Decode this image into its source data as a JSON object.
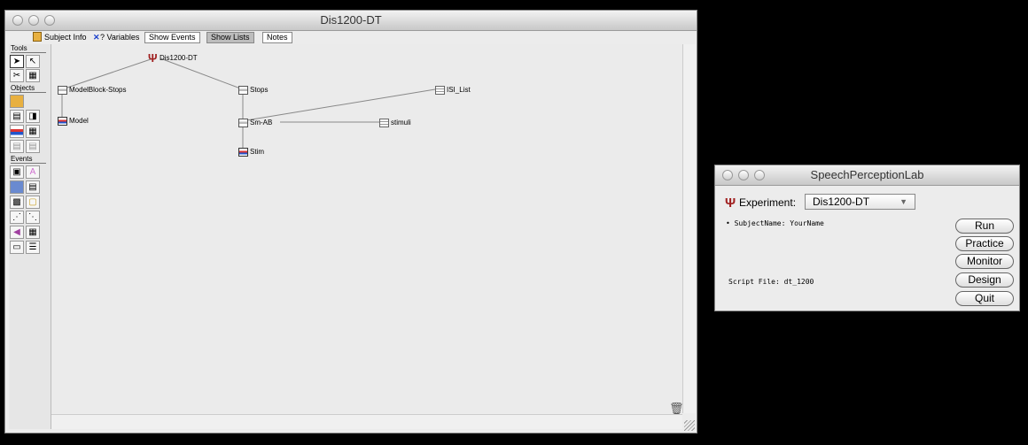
{
  "main_window": {
    "title": "Dis1200-DT",
    "toolbar": {
      "subject_info": "Subject Info",
      "variables": "? Variables",
      "show_events": "Show Events",
      "show_lists": "Show Lists",
      "notes": "Notes"
    },
    "palette": {
      "tools_header": "Tools",
      "objects_header": "Objects",
      "events_header": "Events"
    },
    "nodes": {
      "root": "Dis1200-DT",
      "modelblock": "ModelBlock-Stops",
      "model": "Model",
      "stops": "Stops",
      "isi_list": "ISI_List",
      "sm_ab": "Sm-AB",
      "stimuli": "stimuli",
      "stim": "Stim"
    }
  },
  "launcher": {
    "title": "SpeechPerceptionLab",
    "experiment_label": "Experiment:",
    "experiment_value": "Dis1200-DT",
    "subject_line": "• SubjectName: YourName",
    "script_line": "Script File: dt_1200",
    "buttons": {
      "run": "Run",
      "practice": "Practice",
      "monitor": "Monitor",
      "design": "Design",
      "quit": "Quit"
    }
  }
}
